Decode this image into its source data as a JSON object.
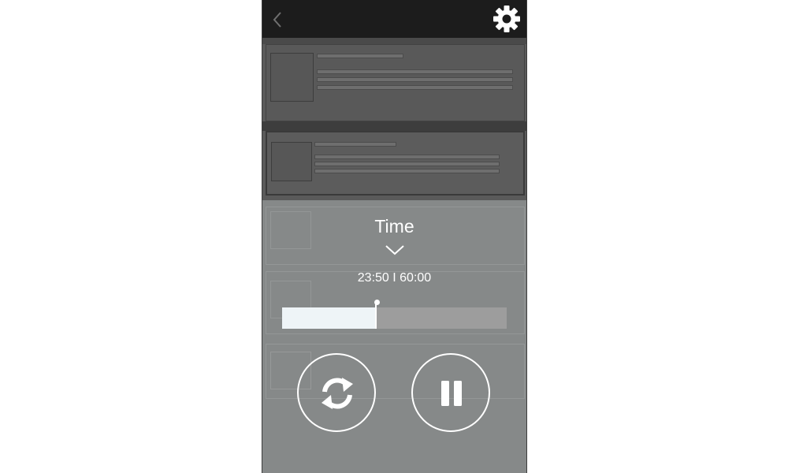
{
  "topbar": {
    "back_icon": "chevron-left-icon",
    "settings_icon": "gear-icon"
  },
  "sheet": {
    "title": "Time",
    "collapse_icon": "chevron-down-icon",
    "elapsed": "23:50",
    "total": "60:00",
    "time_readout": "23:50 I 60:00",
    "progress_fraction": 0.4167
  },
  "controls": {
    "replay_icon": "refresh-icon",
    "pause_icon": "pause-icon"
  },
  "colors": {
    "topbar": "#1c1c1c",
    "sheet": "#8c8f8f",
    "progress_fill": "#eef4f7",
    "progress_track": "#9d9d9d",
    "foreground": "#ffffff"
  }
}
